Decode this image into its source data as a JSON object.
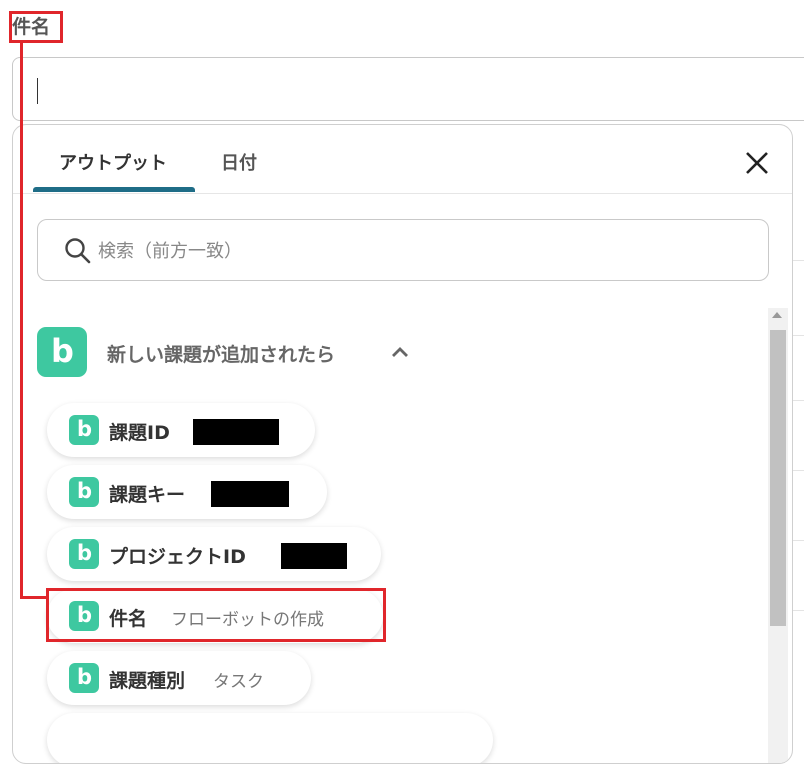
{
  "field": {
    "label": "件名",
    "value": ""
  },
  "popup": {
    "tabs": [
      {
        "label": "アウトプット",
        "active": true
      },
      {
        "label": "日付",
        "active": false
      }
    ],
    "close_icon": "close-icon",
    "search": {
      "placeholder": "検索（前方一致）",
      "icon": "search-icon"
    },
    "group": {
      "title": "新しい課題が追加されたら",
      "app_letter": "b",
      "expanded": true,
      "items": [
        {
          "label": "課題ID",
          "value": "",
          "redacted": true
        },
        {
          "label": "課題キー",
          "value": "",
          "redacted": true
        },
        {
          "label": "プロジェクトID",
          "value": "",
          "redacted": true
        },
        {
          "label": "件名",
          "value": "フローボットの作成",
          "highlighted": true
        },
        {
          "label": "課題種別",
          "value": "タスク"
        }
      ]
    }
  },
  "colors": {
    "brand": "#3ec8a0",
    "tab_underline": "#1f6d87",
    "annotation": "#e0262b"
  }
}
